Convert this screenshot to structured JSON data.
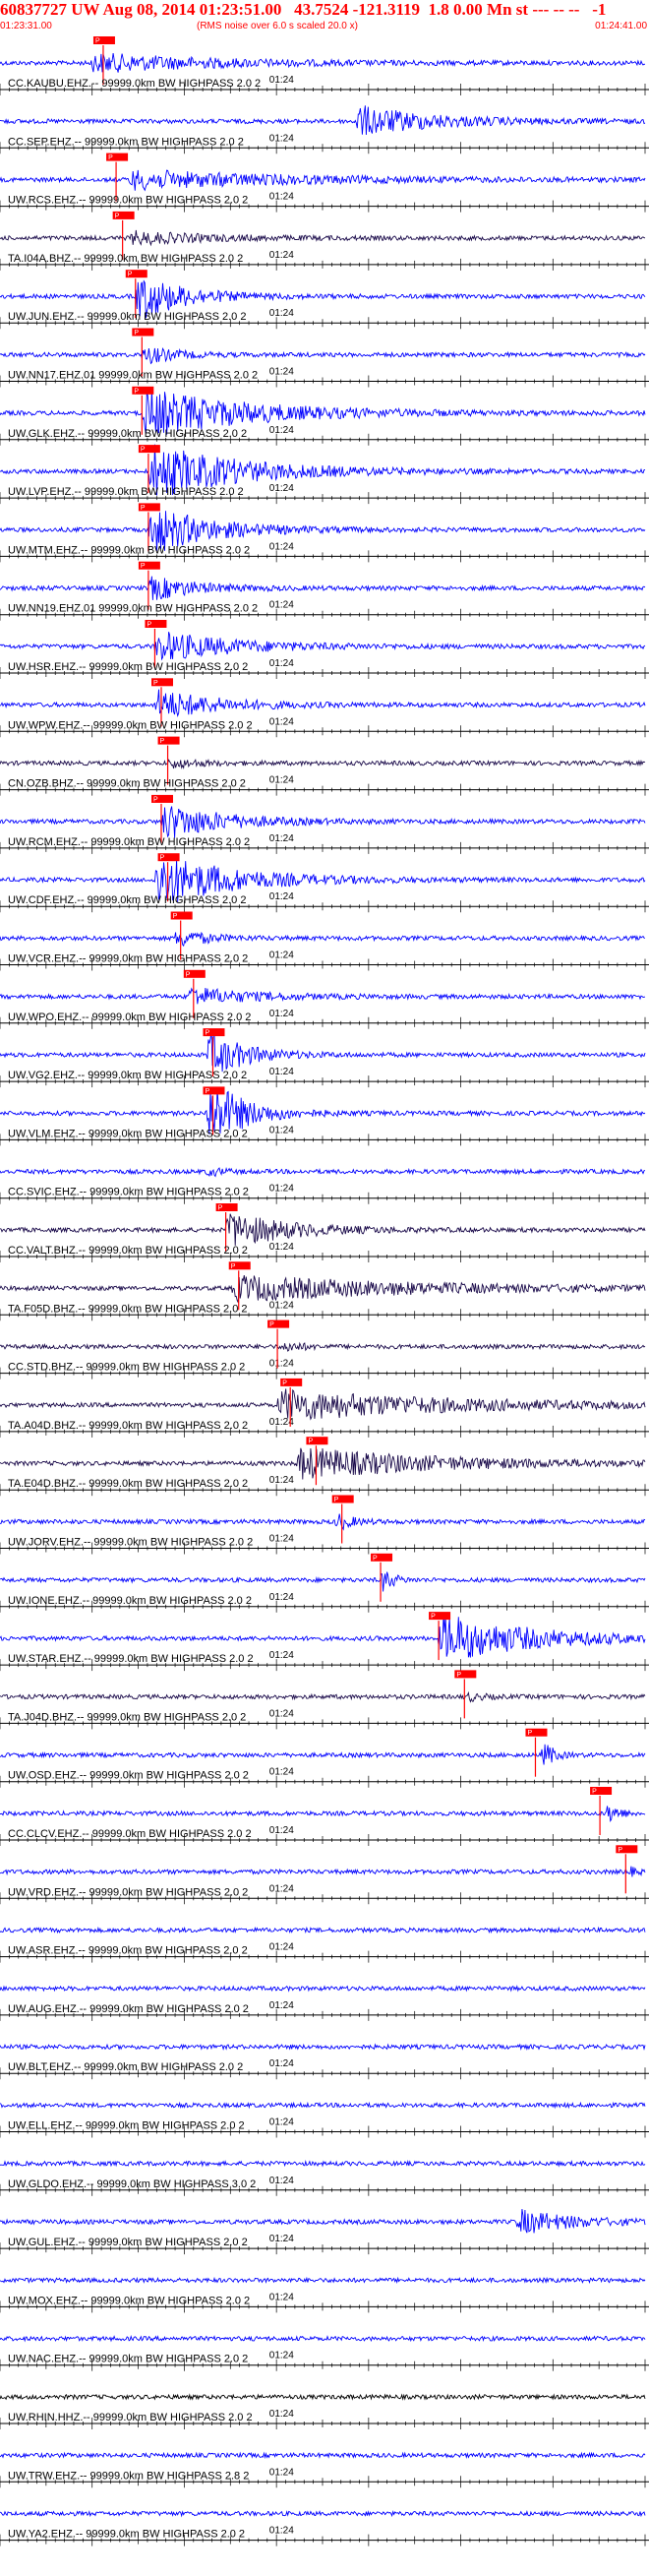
{
  "header": {
    "title": "60837727 UW Aug 08, 2014 01:23:51.00   43.7524 -121.3119  1.8 0.00 Mn st --- -- --   -1",
    "start_time": "01:23:31.00",
    "rms_note": "(RMS noise over 6.0 s scaled 20.0 x)",
    "end_time": "01:24:41.00"
  },
  "chart_data": {
    "type": "line",
    "title": "60837727 UW Aug 08, 2014 01:23:51.00   43.7524 -121.3119  1.8 0.00 Mn st --- -- --   -1",
    "x_range": [
      "01:23:31.00",
      "01:24:41.00"
    ],
    "minute_label": "01:24",
    "pick_label": "P",
    "colors": {
      "trace": "#0000ff",
      "trace_dark": "#1a0a4a",
      "trace_black": "#000000",
      "pick": "#ff0000",
      "axis": "#000000"
    },
    "traces": [
      {
        "label": "CC.KAUBU.EHZ.-- 99999.0km BW  HIGHPASS  2.0  2",
        "color": "blue",
        "pick": 0.16,
        "event": [
          0.14,
          0.4,
          3
        ]
      },
      {
        "label": "CC.SEP.EHZ.-- 99999.0km BW  HIGHPASS  2.0  2",
        "color": "blue",
        "pick": null,
        "event": [
          0.55,
          0.25,
          5
        ]
      },
      {
        "label": "UW.RCS.EHZ.-- 99999.0km BW  HIGHPASS  2.0  2",
        "color": "blue",
        "pick": 0.18,
        "event": [
          0.2,
          0.5,
          3
        ]
      },
      {
        "label": "TA.I04A.BHZ.-- 99999.0km BW  HIGHPASS  2.0  2",
        "color": "dark",
        "pick": 0.19,
        "event": [
          0.2,
          0.25,
          2
        ]
      },
      {
        "label": "UW.JUN.EHZ.-- 99999.0km BW  HIGHPASS  2.0  2",
        "color": "blue",
        "pick": 0.21,
        "event": [
          0.21,
          0.15,
          8
        ]
      },
      {
        "label": "UW.NN17.EHZ.01 99999.0km BW  HIGHPASS  2.0  2",
        "color": "blue",
        "pick": 0.22,
        "event": [
          0.22,
          0.1,
          3
        ]
      },
      {
        "label": "UW.GLK.EHZ.-- 99999.0km BW  HIGHPASS  2.0  2",
        "color": "blue",
        "pick": 0.22,
        "event": [
          0.22,
          0.35,
          8
        ]
      },
      {
        "label": "UW.LVP.EHZ.-- 99999.0km BW  HIGHPASS  2.0  2",
        "color": "blue",
        "pick": 0.23,
        "event": [
          0.23,
          0.3,
          9
        ]
      },
      {
        "label": "UW.MTM.EHZ.-- 99999.0km BW  HIGHPASS  2.0  2",
        "color": "blue",
        "pick": 0.23,
        "event": [
          0.23,
          0.2,
          8
        ]
      },
      {
        "label": "UW.NN19.EHZ.01 99999.0km BW  HIGHPASS  2.0  2",
        "color": "blue",
        "pick": 0.23,
        "event": [
          0.23,
          0.15,
          4
        ]
      },
      {
        "label": "UW.HSR.EHZ.-- 99999.0km BW  HIGHPASS  2.0  2",
        "color": "blue",
        "pick": 0.24,
        "event": [
          0.24,
          0.25,
          5
        ]
      },
      {
        "label": "UW.WPW.EHZ.-- 99999.0km BW  HIGHPASS  2.0  2",
        "color": "blue",
        "pick": 0.25,
        "event": [
          0.24,
          0.2,
          5
        ]
      },
      {
        "label": "CN.OZB.BHZ.-- 99999.0km BW  HIGHPASS  2.0  2",
        "color": "dark",
        "pick": 0.26,
        "event": [
          0.26,
          0.1,
          1.5
        ]
      },
      {
        "label": "UW.RCM.EHZ.-- 99999.0km BW  HIGHPASS  2.0  2",
        "color": "blue",
        "pick": 0.25,
        "event": [
          0.25,
          0.2,
          6
        ]
      },
      {
        "label": "UW.CDF.EHZ.-- 99999.0km BW  HIGHPASS  2.0  2",
        "color": "blue",
        "pick": 0.26,
        "event": [
          0.24,
          0.25,
          9
        ]
      },
      {
        "label": "UW.VCR.EHZ.-- 99999.0km BW  HIGHPASS  2.0  2",
        "color": "blue",
        "pick": 0.28,
        "event": [
          0.27,
          0.1,
          3
        ]
      },
      {
        "label": "UW.WPO.EHZ.-- 99999.0km BW  HIGHPASS  2.0  2",
        "color": "blue",
        "pick": 0.3,
        "event": [
          0.29,
          0.2,
          3
        ]
      },
      {
        "label": "UW.VG2.EHZ.-- 99999.0km BW  HIGHPASS  2.0  2",
        "color": "blue",
        "pick": 0.33,
        "event": [
          0.32,
          0.12,
          8
        ]
      },
      {
        "label": "UW.VLM.EHZ.-- 99999.0km BW  HIGHPASS  2.0  2",
        "color": "blue",
        "pick": 0.33,
        "event": [
          0.32,
          0.12,
          12
        ]
      },
      {
        "label": "CC.SVIC.EHZ.-- 99999.0km BW  HIGHPASS  2.0  2",
        "color": "blue",
        "pick": null,
        "event": [
          0.32,
          0.05,
          1.5
        ]
      },
      {
        "label": "CC.VALT.BHZ.-- 99999.0km BW  HIGHPASS  2.0  2",
        "color": "dark",
        "pick": 0.35,
        "event": [
          0.35,
          0.2,
          6
        ]
      },
      {
        "label": "TA.F05D.BHZ.-- 99999.0km BW  HIGHPASS  2.0  2",
        "color": "dark",
        "pick": 0.37,
        "event": [
          0.36,
          0.6,
          4
        ]
      },
      {
        "label": "CC.STD.BHZ.-- 99999.0km BW  HIGHPASS  2.0  2",
        "color": "dark",
        "pick": 0.43,
        "event": [
          0.44,
          0.05,
          2
        ]
      },
      {
        "label": "TA.A04D.BHZ.-- 99999.0km BW  HIGHPASS  2.0  2",
        "color": "dark",
        "pick": 0.45,
        "event": [
          0.43,
          0.55,
          5
        ]
      },
      {
        "label": "TA.E04D.BHZ.-- 99999.0km BW  HIGHPASS  2.0  2",
        "color": "dark",
        "pick": 0.49,
        "event": [
          0.46,
          0.45,
          5
        ]
      },
      {
        "label": "UW.JORV.EHZ.-- 99999.0km BW  HIGHPASS  2.0  2",
        "color": "blue",
        "pick": 0.53,
        "event": [
          0.52,
          0.05,
          3
        ]
      },
      {
        "label": "UW.IONE.EHZ.-- 99999.0km BW  HIGHPASS  2.0  2",
        "color": "blue",
        "pick": 0.59,
        "event": [
          0.59,
          0.03,
          6
        ]
      },
      {
        "label": "UW.STAR.EHZ.-- 99999.0km BW  HIGHPASS  2.0  2",
        "color": "blue",
        "pick": 0.68,
        "event": [
          0.68,
          0.3,
          8
        ]
      },
      {
        "label": "TA.J04D.BHZ.-- 99999.0km BW  HIGHPASS  2.0  2",
        "color": "dark",
        "pick": 0.72,
        "event": [
          0.72,
          0.05,
          1.5
        ]
      },
      {
        "label": "UW.OSD.EHZ.-- 99999.0km BW  HIGHPASS  2.0  2",
        "color": "blue",
        "pick": 0.83,
        "event": [
          0.84,
          0.03,
          6
        ]
      },
      {
        "label": "CC.CLCV.EHZ.-- 99999.0km BW  HIGHPASS  2.0  2",
        "color": "blue",
        "pick": 0.93,
        "event": [
          0.94,
          0.03,
          5
        ]
      },
      {
        "label": "UW.VRD.EHZ.-- 99999.0km BW  HIGHPASS  2.0  2",
        "color": "blue",
        "pick": 0.97,
        "event": [
          0.97,
          0.03,
          2
        ]
      },
      {
        "label": "UW.ASR.EHZ.-- 99999.0km BW  HIGHPASS  2.0  2",
        "color": "blue",
        "pick": null,
        "event": null
      },
      {
        "label": "UW.AUG.EHZ.-- 99999.0km BW  HIGHPASS  2.0  2",
        "color": "blue",
        "pick": null,
        "event": null
      },
      {
        "label": "UW.BLT.EHZ.-- 99999.0km BW  HIGHPASS  2.0  2",
        "color": "blue",
        "pick": null,
        "event": null
      },
      {
        "label": "UW.ELL.EHZ.-- 99999.0km BW  HIGHPASS  2.0  2",
        "color": "blue",
        "pick": null,
        "event": null
      },
      {
        "label": "UW.GLDO.EHZ.-- 99999.0km BW  HIGHPASS  3.0  2",
        "color": "blue",
        "pick": null,
        "event": null
      },
      {
        "label": "UW.GUL.EHZ.-- 99999.0km BW  HIGHPASS  2.0  2",
        "color": "blue",
        "pick": null,
        "event": [
          0.8,
          0.18,
          4
        ]
      },
      {
        "label": "UW.MOX.EHZ.-- 99999.0km BW  HIGHPASS  2.0  2",
        "color": "blue",
        "pick": null,
        "event": null
      },
      {
        "label": "UW.NAC.EHZ.-- 99999.0km BW  HIGHPASS  2.0  2",
        "color": "blue",
        "pick": null,
        "event": null
      },
      {
        "label": "UW.RHIN.HHZ.-- 99999.0km BW  HIGHPASS  2.0  2",
        "color": "black",
        "pick": null,
        "event": null
      },
      {
        "label": "UW.TRW.EHZ.-- 99999.0km BW  HIGHPASS  2.8  2",
        "color": "blue",
        "pick": null,
        "event": null
      },
      {
        "label": "UW.YA2.EHZ.-- 99999.0km BW  HIGHPASS  2.0  2",
        "color": "blue",
        "pick": null,
        "event": null
      }
    ]
  }
}
